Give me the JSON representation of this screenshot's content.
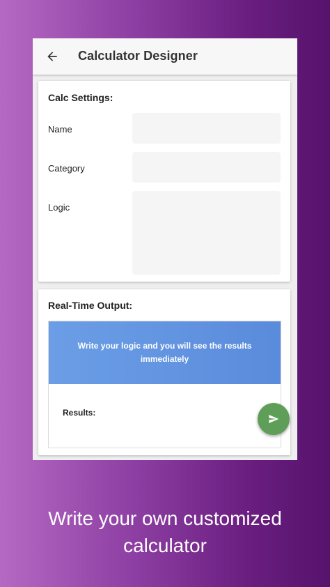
{
  "app": {
    "title": "Calculator Designer"
  },
  "settings": {
    "heading": "Calc Settings:",
    "name_label": "Name",
    "category_label": "Category",
    "logic_label": "Logic"
  },
  "output": {
    "heading": "Real-Time Output:",
    "banner_text": "Write your logic and you will see the results immediately",
    "results_label": "Results:"
  },
  "promo": {
    "caption_line1": "Write your own customized",
    "caption_line2": "calculator"
  },
  "colors": {
    "banner": "#6b9ee6",
    "fab": "#5f9e58",
    "background_start": "#b569c3",
    "background_end": "#56136c"
  },
  "icons": {
    "back": "back-arrow-icon",
    "send": "send-icon"
  }
}
